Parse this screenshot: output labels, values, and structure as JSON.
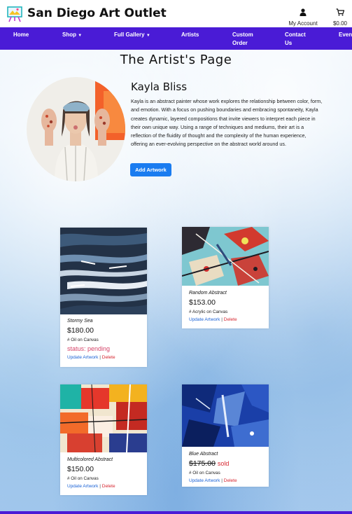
{
  "header": {
    "brand": "San Diego Art Outlet",
    "account_label": "My Account",
    "cart_total": "$0.00"
  },
  "nav": {
    "items": [
      "Home",
      "Shop",
      "Full Gallery",
      "Artists",
      "Custom Order",
      "Contact Us",
      "Events"
    ]
  },
  "page": {
    "title": "The Artist's Page"
  },
  "artist": {
    "name": "Kayla Bliss",
    "bio": "Kayla is an abstract painter whose work explores the relationship between color, form, and emotion. With a focus on pushing boundaries and embracing spontaneity, Kayla creates dynamic, layered compositions that invite viewers to interpret each piece in their own unique way. Using a range of techniques and mediums, their art is a reflection of the fluidity of thought and the complexity of the human experience, offering an ever-evolving perspective on the abstract world around us.",
    "add_button": "Add Artwork"
  },
  "artworks": [
    {
      "title": "Stormy Sea",
      "price": "$180.00",
      "medium": "Oil on Canvas",
      "status": "status: pending",
      "update_label": "Update Artwork",
      "separator": "|",
      "delete_label": "Delete"
    },
    {
      "title": "Random Abstract",
      "price": "$153.00",
      "medium": "Acrylic on Canvas",
      "update_label": "Update Artwork",
      "separator": "|",
      "delete_label": "Delete"
    },
    {
      "title": "Multicolored Abstract",
      "price": "$150.00",
      "medium": "Oil on Canvas",
      "update_label": "Update Artwork",
      "separator": "|",
      "delete_label": "Delete"
    },
    {
      "title": "Blue Abstract",
      "price": "$175.00",
      "sold_label": "sold",
      "medium": "Oil on Canvas",
      "update_label": "Update Artwork",
      "separator": "|",
      "delete_label": "Delete"
    }
  ],
  "colors": {
    "nav_bg": "#4a1bd6",
    "button_blue": "#1a7cf0",
    "link_blue": "#1a62d6",
    "delete_red": "#d6242e",
    "status_pink": "#d6456a"
  },
  "icons": {
    "logo": "easel-painting-icon",
    "account": "user-icon",
    "cart": "cart-icon",
    "medium": "hash-icon",
    "dropdown": "caret-down-icon"
  }
}
